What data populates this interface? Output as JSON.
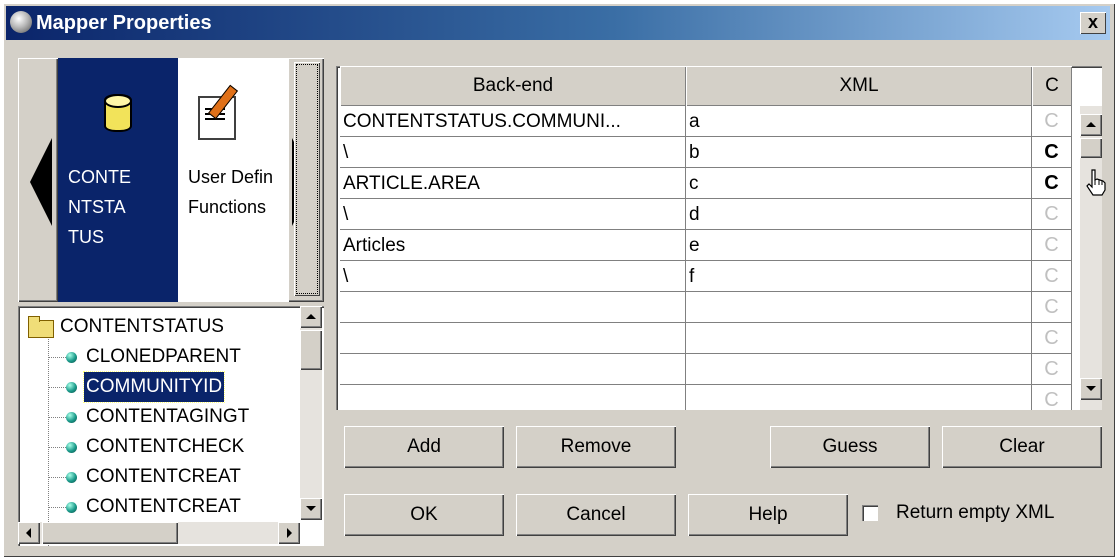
{
  "window": {
    "title": "Mapper Properties",
    "close_label": "x"
  },
  "palette": {
    "items": [
      {
        "label": "CONTE\nNTSTA\nTUS",
        "icon": "database-icon",
        "selected": true
      },
      {
        "label": "User Defin\nFunctions",
        "icon": "edit-document-icon",
        "selected": false
      }
    ]
  },
  "tree": {
    "root": "CONTENTSTATUS",
    "children": [
      "CLONEDPARENT",
      "COMMUNITYID",
      "CONTENTAGINGT",
      "CONTENTCHECK",
      "CONTENTCREAT",
      "CONTENTCREAT"
    ],
    "selected_index": 1
  },
  "table": {
    "headers": [
      "Back-end",
      "XML",
      "C"
    ],
    "rows": [
      {
        "backend": "CONTENTSTATUS.COMMUNI...",
        "xml": "a",
        "c": "C",
        "c_active": false
      },
      {
        "backend": "\\",
        "xml": "b",
        "c": "C",
        "c_active": true
      },
      {
        "backend": "ARTICLE.AREA",
        "xml": "c",
        "c": "C",
        "c_active": true
      },
      {
        "backend": "\\",
        "xml": "d",
        "c": "C",
        "c_active": false
      },
      {
        "backend": "Articles",
        "xml": "e",
        "c": "C",
        "c_active": false
      },
      {
        "backend": "\\",
        "xml": "f",
        "c": "C",
        "c_active": false
      },
      {
        "backend": "",
        "xml": "",
        "c": "C",
        "c_active": false
      },
      {
        "backend": "",
        "xml": "",
        "c": "C",
        "c_active": false
      },
      {
        "backend": "",
        "xml": "",
        "c": "C",
        "c_active": false
      },
      {
        "backend": "",
        "xml": "",
        "c": "C",
        "c_active": false
      }
    ]
  },
  "buttons": {
    "add": "Add",
    "remove": "Remove",
    "guess": "Guess",
    "clear": "Clear",
    "ok": "OK",
    "cancel": "Cancel",
    "help": "Help"
  },
  "options": {
    "return_empty_xml_label": "Return empty XML",
    "return_empty_xml_checked": false
  },
  "colors": {
    "titlebar": "#0a246a",
    "selection": "#0a246a",
    "face": "#d4d0c8"
  }
}
